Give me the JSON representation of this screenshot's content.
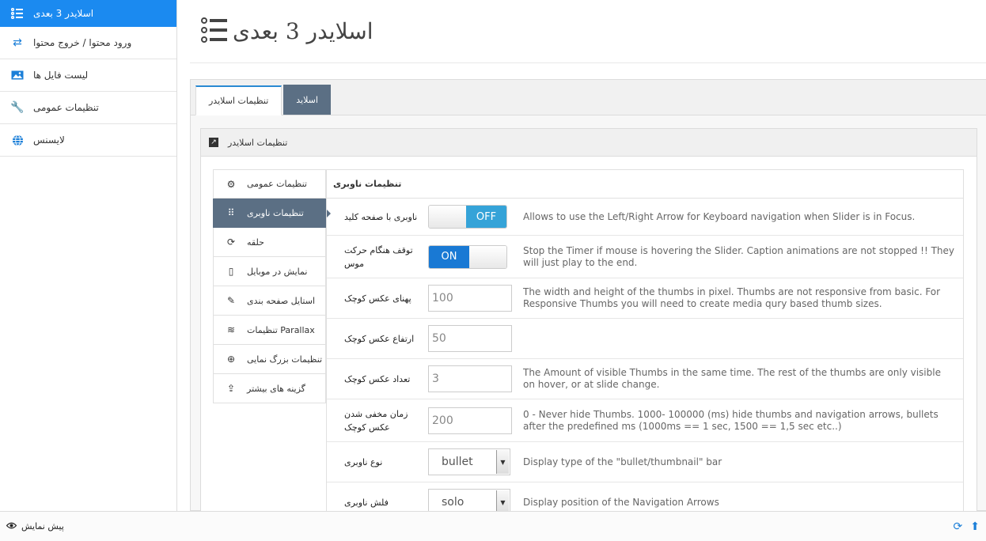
{
  "page": {
    "title": "اسلایدر 3 بعدی"
  },
  "sidebar": {
    "items": [
      {
        "label": "اسلایدر 3 بعدی"
      },
      {
        "label": "ورود محتوا / خروج محتوا"
      },
      {
        "label": "لیست فایل ها"
      },
      {
        "label": "تنظیمات عمومی"
      },
      {
        "label": "لایسنس"
      }
    ]
  },
  "tabs": [
    {
      "label": "تنظیمات اسلایدر"
    },
    {
      "label": "اسلاید"
    }
  ],
  "section": {
    "title": "تنظیمات اسلایدر"
  },
  "subnav": {
    "items": [
      {
        "label": "تنظیمات عمومی"
      },
      {
        "label": "تنظیمات ناوبری"
      },
      {
        "label": "حلقه"
      },
      {
        "label": "نمایش در موبایل"
      },
      {
        "label": "استایل صفحه بندی"
      },
      {
        "label": "تنظیمات Parallax"
      },
      {
        "label": "تنظیمات بزرگ نمایی"
      },
      {
        "label": "گزینه های بیشتر"
      }
    ]
  },
  "settings": {
    "title": "تنظیمات ناوبری",
    "rows": [
      {
        "label": "ناوبری با صفحه کلید",
        "toggle": "OFF",
        "desc": "Allows to use the Left/Right Arrow for Keyboard navigation when Slider is in Focus."
      },
      {
        "label": "توقف هنگام حرکت موس",
        "toggle": "ON",
        "desc": "Stop the Timer if mouse is hovering the Slider. Caption animations are not stopped !! They will just play to the end."
      },
      {
        "label": "پهنای عکس کوچک",
        "value": "100",
        "desc": "The width and height of the thumbs in pixel. Thumbs are not responsive from basic. For Responsive Thumbs you will need to create media qury based thumb sizes."
      },
      {
        "label": "ارتفاع عکس کوچک",
        "value": "50",
        "desc": ""
      },
      {
        "label": "تعداد عکس کوچک",
        "value": "3",
        "desc": "The Amount of visible Thumbs in the same time. The rest of the thumbs are only visible on hover, or at slide change."
      },
      {
        "label": "زمان مخفی شدن عکس کوچک",
        "value": "200",
        "desc": "0 - Never hide Thumbs. 1000- 100000 (ms) hide thumbs and navigation arrows, bullets after the predefined ms (1000ms == 1 sec, 1500 == 1,5 sec etc..)"
      },
      {
        "label": "نوع ناوبری",
        "select": "bullet",
        "desc": "Display type of the \"bullet/thumbnail\" bar"
      },
      {
        "label": "فلش ناوبری",
        "select": "solo",
        "desc": "Display position of the Navigation Arrows"
      }
    ]
  },
  "footer": {
    "preview_label": "پیش نمایش"
  }
}
